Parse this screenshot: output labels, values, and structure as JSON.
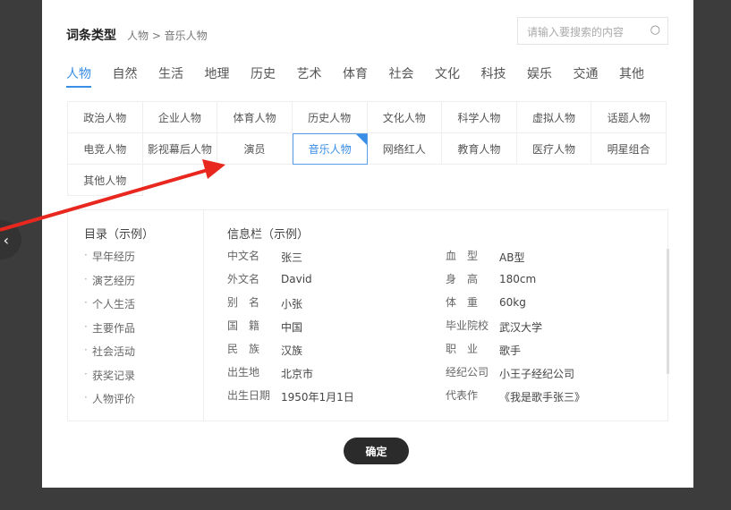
{
  "header": {
    "title": "词条类型",
    "breadcrumb": "人物 > 音乐人物",
    "search_placeholder": "请输入要搜索的内容",
    "search_icon": "search-icon"
  },
  "tabs": [
    "人物",
    "自然",
    "生活",
    "地理",
    "历史",
    "艺术",
    "体育",
    "社会",
    "文化",
    "科技",
    "娱乐",
    "交通",
    "其他"
  ],
  "active_tab": "人物",
  "subcategories": [
    "政治人物",
    "企业人物",
    "体育人物",
    "历史人物",
    "文化人物",
    "科学人物",
    "虚拟人物",
    "话题人物",
    "电竞人物",
    "影视幕后人物",
    "演员",
    "音乐人物",
    "网络红人",
    "教育人物",
    "医疗人物",
    "明星组合",
    "其他人物"
  ],
  "selected_subcategory": "音乐人物",
  "preview": {
    "toc_title": "目录（示例）",
    "toc": [
      "早年经历",
      "演艺经历",
      "个人生活",
      "主要作品",
      "社会活动",
      "获奖记录",
      "人物评价"
    ],
    "info_title": "信息栏（示例）",
    "info_left": [
      {
        "k": "中文名",
        "v": "张三"
      },
      {
        "k": "外文名",
        "v": "David"
      },
      {
        "k": "别　名",
        "v": "小张"
      },
      {
        "k": "国　籍",
        "v": "中国"
      },
      {
        "k": "民　族",
        "v": "汉族"
      },
      {
        "k": "出生地",
        "v": "北京市"
      },
      {
        "k": "出生日期",
        "v": "1950年1月1日"
      }
    ],
    "info_right": [
      {
        "k": "血　型",
        "v": "AB型"
      },
      {
        "k": "身　高",
        "v": "180cm"
      },
      {
        "k": "体　重",
        "v": "60kg"
      },
      {
        "k": "毕业院校",
        "v": "武汉大学"
      },
      {
        "k": "职　业",
        "v": "歌手"
      },
      {
        "k": "经纪公司",
        "v": "小王子经纪公司"
      },
      {
        "k": "代表作",
        "v": "《我是歌手张三》"
      }
    ]
  },
  "confirm_label": "确定",
  "colors": {
    "accent": "#3a8ee6",
    "annotation_arrow": "#e8281e",
    "overlay": "#3c3c3c"
  }
}
